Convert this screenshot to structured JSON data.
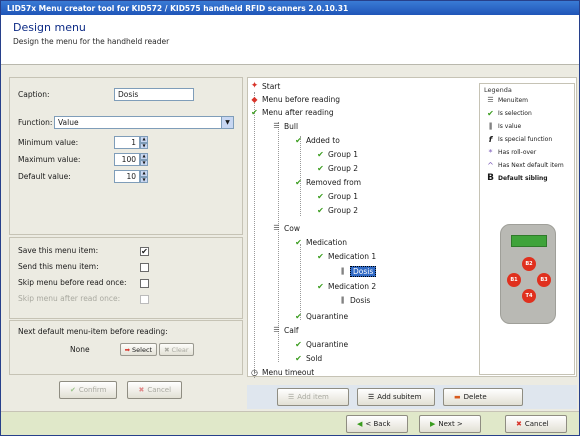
{
  "window": {
    "title": "LID57x Menu creator tool for KID572 / KID575 handheld RFID scanners 2.0.10.31"
  },
  "header": {
    "title": "Design menu",
    "subtitle": "Design the menu for the handheld reader"
  },
  "form": {
    "caption_label": "Caption:",
    "caption_value": "Dosis",
    "function_label": "Function:",
    "function_value": "Value",
    "min_label": "Minimum value:",
    "min_value": "1",
    "max_label": "Maximum value:",
    "max_value": "100",
    "default_label": "Default value:",
    "default_value": "10"
  },
  "options": {
    "save_label": "Save this menu item:",
    "save_checked": "✔",
    "send_label": "Send this menu item:",
    "skip_label": "Skip menu before read once:",
    "skip_after_label": "Skip menu after read once:"
  },
  "next_default": {
    "label": "Next default menu-item before reading:",
    "value": "None",
    "select_label": "Select",
    "clear_label": "Clear"
  },
  "left_buttons": {
    "confirm": "Confirm",
    "cancel": "Cancel"
  },
  "tree": {
    "start": "Start",
    "before": "Menu before reading",
    "after": "Menu after reading",
    "bull": "Bull",
    "added_to": "Added to",
    "group1a": "Group 1",
    "group2a": "Group 2",
    "removed_from": "Removed from",
    "group1b": "Group 1",
    "group2b": "Group 2",
    "cow": "Cow",
    "medication": "Medication",
    "medication1": "Medication 1",
    "dosis1": "Dosis",
    "medication2": "Medication 2",
    "dosis2": "Dosis",
    "quarantine1": "Quarantine",
    "calf": "Calf",
    "quarantine2": "Quarantine",
    "sold": "Sold",
    "timeout": "Menu timeout"
  },
  "legend": {
    "title": "Legenda",
    "items": [
      "Menuitem",
      "Is selection",
      "Is value",
      "Is special function",
      "Has roll-over",
      "Has Next default item",
      "Default sibling"
    ]
  },
  "reader_buttons": [
    "B2",
    "B1",
    "B3",
    "T4"
  ],
  "tree_buttons": {
    "add_item": "Add item",
    "add_subitem": "Add subitem",
    "delete": "Delete"
  },
  "footer": {
    "back": "< Back",
    "next": "Next >",
    "cancel": "Cancel"
  }
}
